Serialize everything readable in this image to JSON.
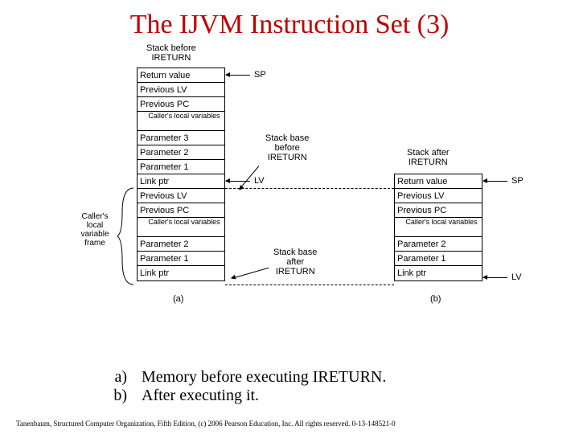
{
  "title": "The IJVM Instruction Set (3)",
  "labels": {
    "stack_before": "Stack before\nIRETURN",
    "stack_base_before": "Stack base\nbefore\nIRETURN",
    "stack_after": "Stack after\nIRETURN",
    "stack_base_after": "Stack base\nafter\nIRETURN",
    "callers_frame": "Caller's\nlocal\nvariable\nframe",
    "sp": "SP",
    "lv": "LV",
    "sub_a": "(a)",
    "sub_b": "(b)"
  },
  "stack_a": [
    "Return value",
    "Previous LV",
    "Previous PC",
    "",
    "Parameter 3",
    "Parameter 2",
    "Parameter 1",
    "Link ptr",
    "Previous LV",
    "Previous PC",
    "",
    "Parameter 2",
    "Parameter 1",
    "Link ptr"
  ],
  "stack_a_gap_label": "Caller's\nlocal\nvariables",
  "stack_b": [
    "Return value",
    "Previous LV",
    "Previous PC",
    "",
    "Parameter 2",
    "Parameter 1",
    "Link ptr"
  ],
  "stack_b_gap_label": "Caller's\nlocal\nvariables",
  "caption": {
    "a_mark": "a)",
    "a_text": "Memory before executing IRETURN.",
    "b_mark": "b)",
    "b_text": "After executing it."
  },
  "footer": "Tanenbaum, Structured Computer Organization, Fifth Edition, (c) 2006 Pearson Education, Inc. All rights reserved. 0-13-148521-0"
}
